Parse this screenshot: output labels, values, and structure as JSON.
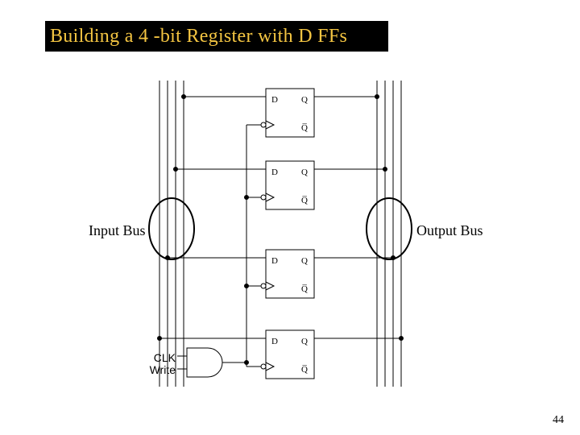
{
  "title": "Building a 4 -bit Register with D FFs",
  "input_bus_label": "Input Bus",
  "output_bus_label": "Output Bus",
  "clk_label": "CLK",
  "write_label": "Write",
  "page_number": "44",
  "ff": {
    "d": "D",
    "q": "Q",
    "qbar": "Q̅"
  }
}
